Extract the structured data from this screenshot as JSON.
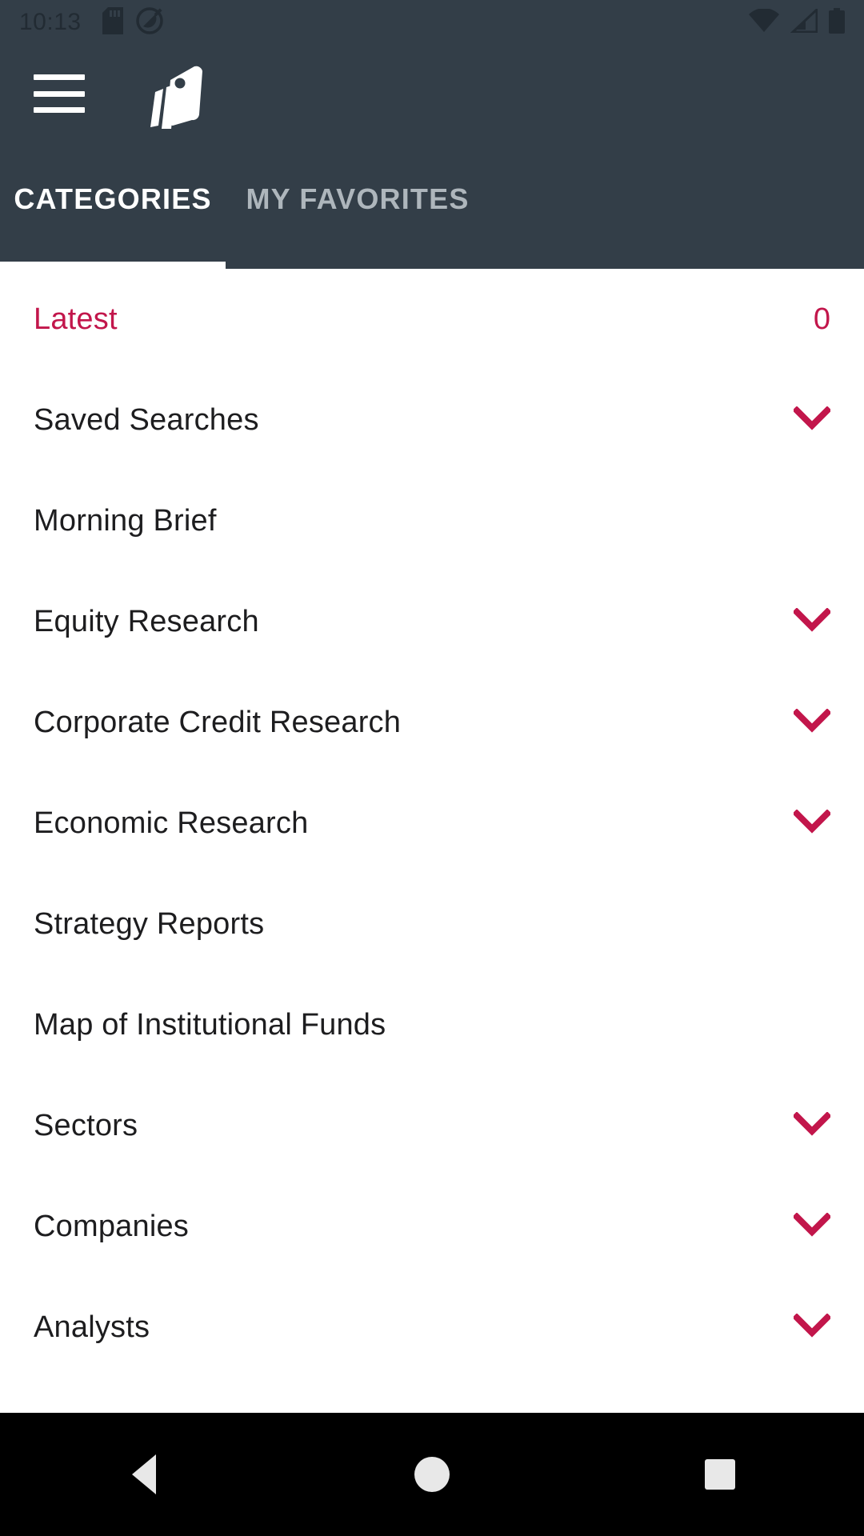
{
  "statusbar": {
    "time": "10:13",
    "left_icons": [
      "sd-card-icon",
      "do-not-disturb-icon"
    ],
    "right_icons": [
      "wifi-icon",
      "cellular-signal-icon",
      "battery-icon"
    ],
    "background_color": "#333E48",
    "icon_color": "#222b33"
  },
  "appbar": {
    "menu_icon": "hamburger-menu-icon",
    "logo_icon": "tag-stack-logo-icon",
    "background_color": "#333E48"
  },
  "tabs": [
    {
      "label": "CATEGORIES",
      "active": true
    },
    {
      "label": "MY FAVORITES",
      "active": false
    }
  ],
  "colors": {
    "accent_red": "#C2164B",
    "header_dark": "#333E48",
    "text_dark": "#1d1d1f",
    "tab_inactive": "#aeb6bc"
  },
  "list": {
    "items": [
      {
        "label": "Latest",
        "count": "0",
        "chevron": false,
        "highlight": true
      },
      {
        "label": "Saved Searches",
        "count": "",
        "chevron": true,
        "highlight": false
      },
      {
        "label": "Morning Brief",
        "count": "",
        "chevron": false,
        "highlight": false
      },
      {
        "label": "Equity Research",
        "count": "",
        "chevron": true,
        "highlight": false
      },
      {
        "label": "Corporate Credit Research",
        "count": "",
        "chevron": true,
        "highlight": false
      },
      {
        "label": "Economic Research",
        "count": "",
        "chevron": true,
        "highlight": false
      },
      {
        "label": "Strategy Reports",
        "count": "",
        "chevron": false,
        "highlight": false
      },
      {
        "label": "Map of Institutional Funds",
        "count": "",
        "chevron": false,
        "highlight": false
      },
      {
        "label": "Sectors",
        "count": "",
        "chevron": true,
        "highlight": false
      },
      {
        "label": "Companies",
        "count": "",
        "chevron": true,
        "highlight": false
      },
      {
        "label": "Analysts",
        "count": "",
        "chevron": true,
        "highlight": false
      }
    ]
  },
  "navbar": {
    "buttons": [
      {
        "name": "back-button",
        "icon": "back-triangle-icon"
      },
      {
        "name": "home-button",
        "icon": "home-circle-icon"
      },
      {
        "name": "recents-button",
        "icon": "recents-square-icon"
      }
    ],
    "background_color": "#000000"
  }
}
